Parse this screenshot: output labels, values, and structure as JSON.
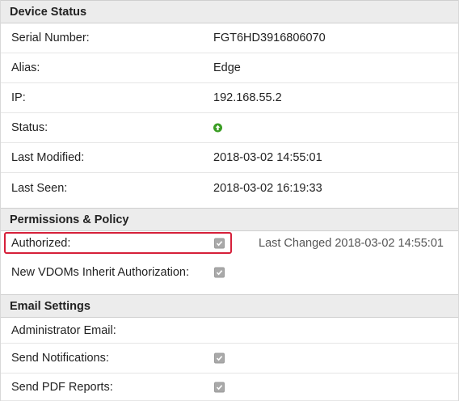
{
  "device_status": {
    "title": "Device Status",
    "rows": [
      {
        "label": "Serial Number:",
        "value": "FGT6HD3916806070"
      },
      {
        "label": "Alias:",
        "value": "Edge"
      },
      {
        "label": "IP:",
        "value": "192.168.55.2"
      },
      {
        "label": "Status:",
        "value": null,
        "icon": "status-up-icon",
        "icon_color": "#3a9d23"
      },
      {
        "label": "Last Modified:",
        "value": "2018-03-02 14:55:01"
      },
      {
        "label": "Last Seen:",
        "value": "2018-03-02 16:19:33"
      }
    ]
  },
  "permissions": {
    "title": "Permissions & Policy",
    "authorized_label": "Authorized:",
    "authorized_checked": true,
    "last_changed": "Last Changed 2018-03-02 14:55:01",
    "inherit_label": "New VDOMs Inherit Authorization:",
    "inherit_checked": true,
    "highlight_color": "#d6203a"
  },
  "email_settings": {
    "title": "Email Settings",
    "admin_email_label": "Administrator Email:",
    "send_notifications_label": "Send Notifications:",
    "send_notifications_checked": true,
    "send_pdf_label": "Send PDF Reports:",
    "send_pdf_checked": true
  }
}
